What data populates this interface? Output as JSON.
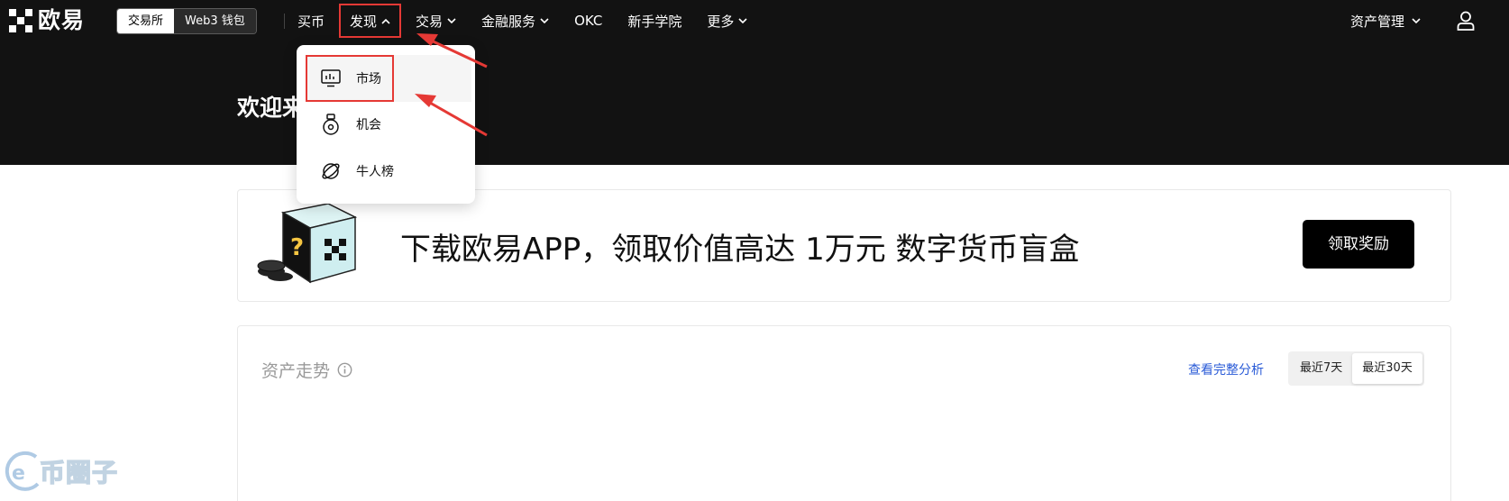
{
  "brand": {
    "name": "欧易"
  },
  "mode_switch": {
    "items": [
      "交易所",
      "Web3 钱包"
    ],
    "active": 0
  },
  "nav": {
    "items": [
      {
        "label": "买币",
        "has_chevron": false
      },
      {
        "label": "发现",
        "has_chevron": true,
        "open": true
      },
      {
        "label": "交易",
        "has_chevron": true
      },
      {
        "label": "金融服务",
        "has_chevron": true
      },
      {
        "label": "OKC",
        "has_chevron": false
      },
      {
        "label": "新手学院",
        "has_chevron": false
      },
      {
        "label": "更多",
        "has_chevron": true
      }
    ],
    "asset_management": "资产管理"
  },
  "welcome": {
    "text": "欢迎来"
  },
  "discover_dropdown": {
    "items": [
      {
        "label": "市场",
        "icon": "market-chart-icon"
      },
      {
        "label": "机会",
        "icon": "opportunity-medal-icon"
      },
      {
        "label": "牛人榜",
        "icon": "leaderboard-planet-icon"
      }
    ]
  },
  "banner": {
    "text": "下载欧易APP，领取价值高达 1万元 数字货币盲盒",
    "button": "领取奖励"
  },
  "asset_trend": {
    "title": "资产走势",
    "link": "查看完整分析",
    "ranges": [
      "最近7天",
      "最近30天"
    ],
    "active_range": 1
  },
  "watermark": {
    "text": "币圈子"
  },
  "colors": {
    "nav_bg": "#121212",
    "highlight_red": "#e53935",
    "link_blue": "#2a5bd7"
  }
}
